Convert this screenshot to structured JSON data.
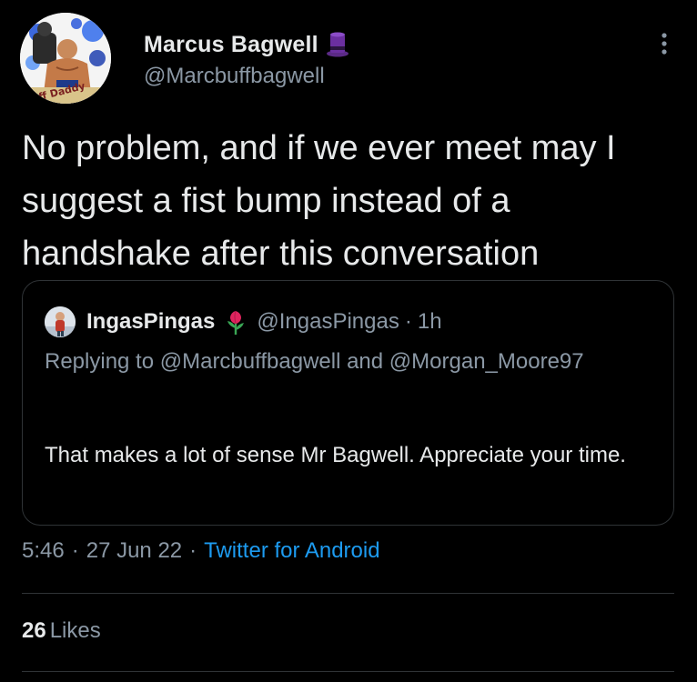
{
  "author": {
    "display_name": "Marcus Bagwell",
    "handle": "@Marcbuffbagwell",
    "badge_icon": "top-hat-icon",
    "avatar_text": "Buff Daddy"
  },
  "tweet": {
    "text": "No problem, and if we ever meet may I suggest a fist bump instead of a handshake after this conversation"
  },
  "quoted_tweet": {
    "display_name": "IngasPingas",
    "badge_icon": "flower-icon",
    "handle": "@IngasPingas",
    "separator": "·",
    "time_ago": "1h",
    "replying_to": "Replying to @Marcbuffbagwell and @Morgan_Moore97",
    "text": "That makes a lot of sense Mr Bagwell. Appreciate your time."
  },
  "meta": {
    "time": "5:46",
    "separator": "·",
    "date": "27 Jun 22",
    "source": "Twitter for Android"
  },
  "stats": {
    "likes_count": "26",
    "likes_label": "Likes"
  },
  "colors": {
    "background": "#000000",
    "text_primary": "#e7e9ea",
    "text_secondary": "#8b98a5",
    "link": "#1d9bf0",
    "border": "#2f3336"
  }
}
